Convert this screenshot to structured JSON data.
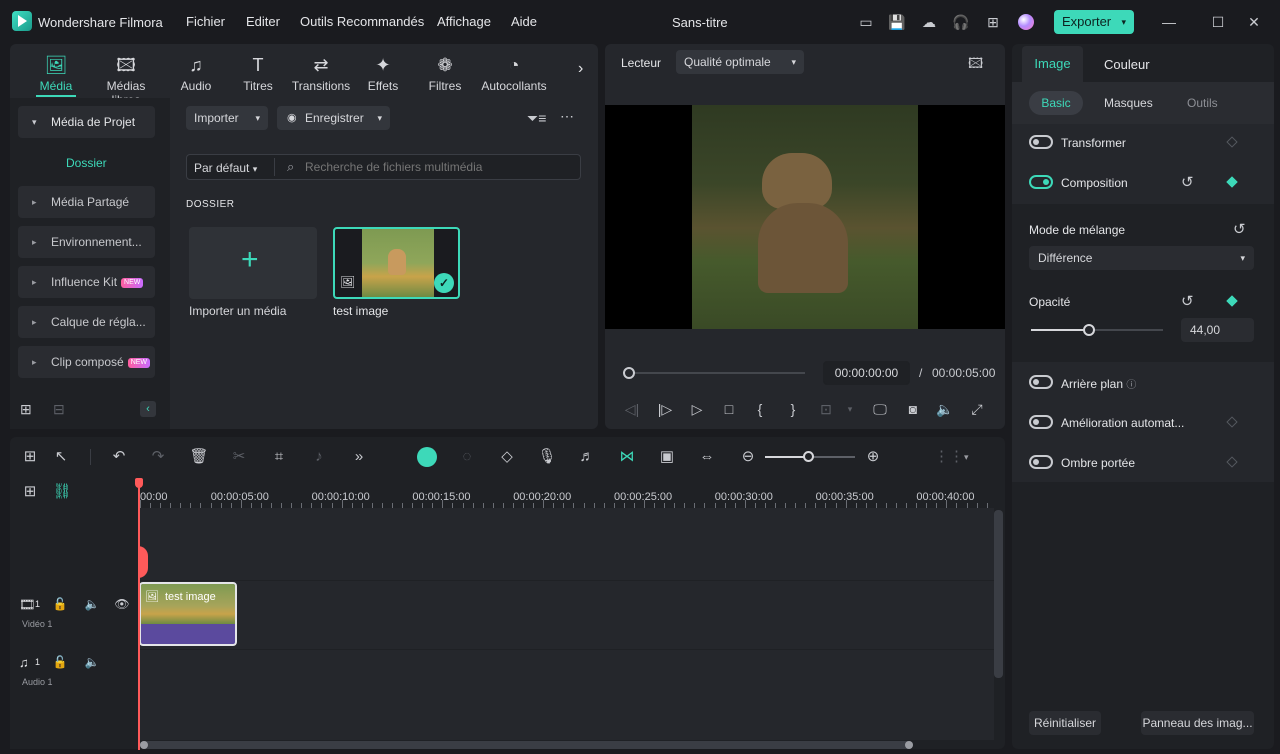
{
  "app": {
    "name": "Wondershare Filmora",
    "title": "Sans-titre",
    "export_label": "Exporter"
  },
  "menu": [
    "Fichier",
    "Editer",
    "Outils Recommandés",
    "Affichage",
    "Aide"
  ],
  "media_tabs": [
    {
      "label": "Média",
      "icon": "media-icon",
      "active": true
    },
    {
      "label": "Médias libres",
      "icon": "stock-media-icon"
    },
    {
      "label": "Audio",
      "icon": "music-note-icon"
    },
    {
      "label": "Titres",
      "icon": "titles-icon"
    },
    {
      "label": "Transitions",
      "icon": "transitions-icon"
    },
    {
      "label": "Effets",
      "icon": "effects-icon"
    },
    {
      "label": "Filtres",
      "icon": "filters-icon"
    },
    {
      "label": "Autocollants",
      "icon": "stickers-icon"
    }
  ],
  "sidebar": {
    "project_media": "Média de Projet",
    "folder": "Dossier",
    "items": [
      {
        "label": "Média Partagé",
        "new": false
      },
      {
        "label": "Environnement...",
        "new": false
      },
      {
        "label": "Influence Kit",
        "new": true
      },
      {
        "label": "Calque de régla...",
        "new": false
      },
      {
        "label": "Clip composé",
        "new": true
      }
    ],
    "new_badge": "NEW"
  },
  "media": {
    "import_label": "Importer",
    "record_label": "Enregistrer",
    "sort_label": "Par défaut",
    "search_placeholder": "Recherche de fichiers multimédia",
    "folder_heading": "DOSSIER",
    "import_tile_label": "Importer un média",
    "items": [
      {
        "label": "test image"
      }
    ]
  },
  "player": {
    "label": "Lecteur",
    "quality": "Qualité optimale",
    "current_time": "00:00:00:00",
    "separator": "/",
    "total_time": "00:00:05:00",
    "progress": 0
  },
  "properties": {
    "tabs": [
      "Image",
      "Couleur"
    ],
    "subtabs": [
      "Basic",
      "Masques",
      "Outils"
    ],
    "transform": "Transformer",
    "composition": "Composition",
    "blend_mode_label": "Mode de mélange",
    "blend_mode_value": "Différence",
    "opacity_label": "Opacité",
    "opacity_value": "44,00",
    "opacity_fraction": 0.44,
    "background": "Arrière plan",
    "auto_enhance": "Amélioration automat...",
    "drop_shadow": "Ombre portée",
    "reset_label": "Réinitialiser",
    "image_panel_label": "Panneau des imag..."
  },
  "timeline": {
    "ticks": [
      "00:00",
      "00:00:05:00",
      "00:00:10:00",
      "00:00:15:00",
      "00:00:20:00",
      "00:00:25:00",
      "00:00:30:00",
      "00:00:35:00",
      "00:00:40:00"
    ],
    "video_track_number": "1",
    "video_track_label": "Vidéo 1",
    "audio_track_number": "1",
    "audio_track_label": "Audio 1",
    "clip_label": "test image"
  },
  "colors": {
    "accent": "#3dd9b9",
    "playhead": "#ff5a5a",
    "clip_bar": "#5b4a9e"
  }
}
